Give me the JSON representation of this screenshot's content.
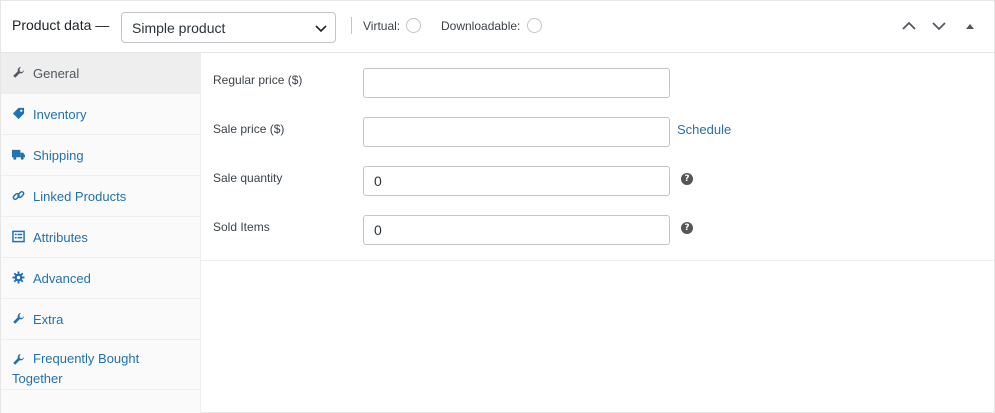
{
  "header": {
    "title": "Product data —",
    "product_type": "Simple product",
    "virtual_label": "Virtual:",
    "downloadable_label": "Downloadable:"
  },
  "sidebar": {
    "tabs": [
      {
        "label": "General",
        "icon": "wrench-icon",
        "active": true
      },
      {
        "label": "Inventory",
        "icon": "tag-icon",
        "active": false
      },
      {
        "label": "Shipping",
        "icon": "truck-icon",
        "active": false
      },
      {
        "label": "Linked Products",
        "icon": "link-icon",
        "active": false
      },
      {
        "label": "Attributes",
        "icon": "list-icon",
        "active": false
      },
      {
        "label": "Advanced",
        "icon": "gear-icon",
        "active": false
      },
      {
        "label": "Extra",
        "icon": "wrench-icon",
        "active": false
      },
      {
        "label": "Frequently Bought Together",
        "icon": "wrench-icon",
        "active": false
      }
    ]
  },
  "fields": {
    "regular_price": {
      "label": "Regular price ($)",
      "value": ""
    },
    "sale_price": {
      "label": "Sale price ($)",
      "value": "",
      "link": "Schedule"
    },
    "sale_quantity": {
      "label": "Sale quantity",
      "value": "0"
    },
    "sold_items": {
      "label": "Sold Items",
      "value": "0"
    }
  },
  "colors": {
    "accent": "#2271b1",
    "text": "#3c434a",
    "active_tab_bg": "#eeeeee"
  }
}
